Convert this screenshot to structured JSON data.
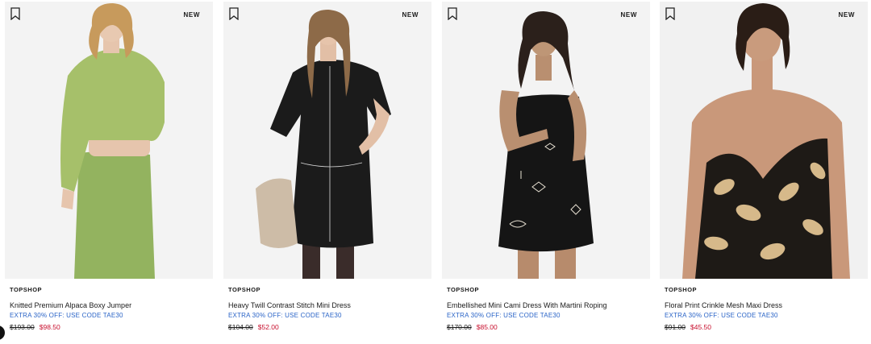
{
  "products": [
    {
      "badge": "NEW",
      "brand": "TOPSHOP",
      "name": "Knitted Premium Alpaca Boxy Jumper",
      "promo": "EXTRA 30% OFF: USE CODE TAE30",
      "was_price": "$193.00",
      "now_price": "$98.50"
    },
    {
      "badge": "NEW",
      "brand": "TOPSHOP",
      "name": "Heavy Twill Contrast Stitch Mini Dress",
      "promo": "EXTRA 30% OFF: USE CODE TAE30",
      "was_price": "$104.00",
      "now_price": "$52.00"
    },
    {
      "badge": "NEW",
      "brand": "TOPSHOP",
      "name": "Embellished Mini Cami Dress With Martini Roping",
      "promo": "EXTRA 30% OFF: USE CODE TAE30",
      "was_price": "$170.00",
      "now_price": "$85.00"
    },
    {
      "badge": "NEW",
      "brand": "TOPSHOP",
      "name": "Floral Print Crinkle Mesh Maxi Dress",
      "promo": "EXTRA 30% OFF: USE CODE TAE30",
      "was_price": "$91.00",
      "now_price": "$45.50"
    }
  ],
  "colors": {
    "promo": "#2a64c7",
    "sale_price": "#c8102e",
    "image_bg": "#f2f2f2"
  },
  "icons": {
    "save": "bookmark-icon"
  }
}
